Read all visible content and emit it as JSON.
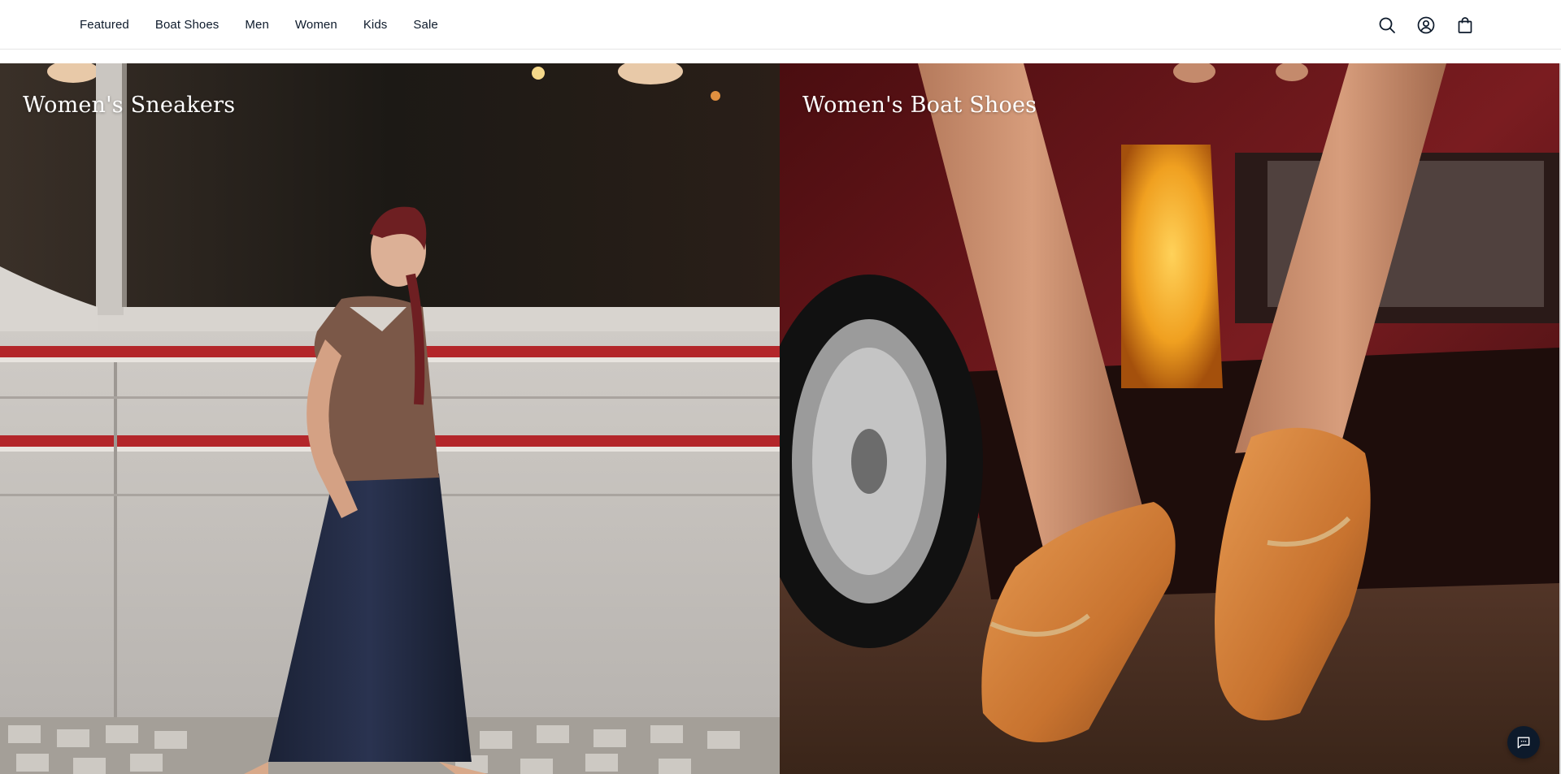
{
  "nav": {
    "items": [
      "Featured",
      "Boat Shoes",
      "Men",
      "Women",
      "Kids",
      "Sale"
    ]
  },
  "header_icons": {
    "search": "search-icon",
    "account": "account-icon",
    "bag": "shopping-bag-icon"
  },
  "panels": [
    {
      "title": "Women's Sneakers"
    },
    {
      "title": "Women's Boat Shoes"
    }
  ],
  "chat": {
    "icon": "chat-icon"
  },
  "colors": {
    "nav_text": "#0d1a2b",
    "chat_bg": "#0d1a2b",
    "title_text": "#ffffff"
  }
}
